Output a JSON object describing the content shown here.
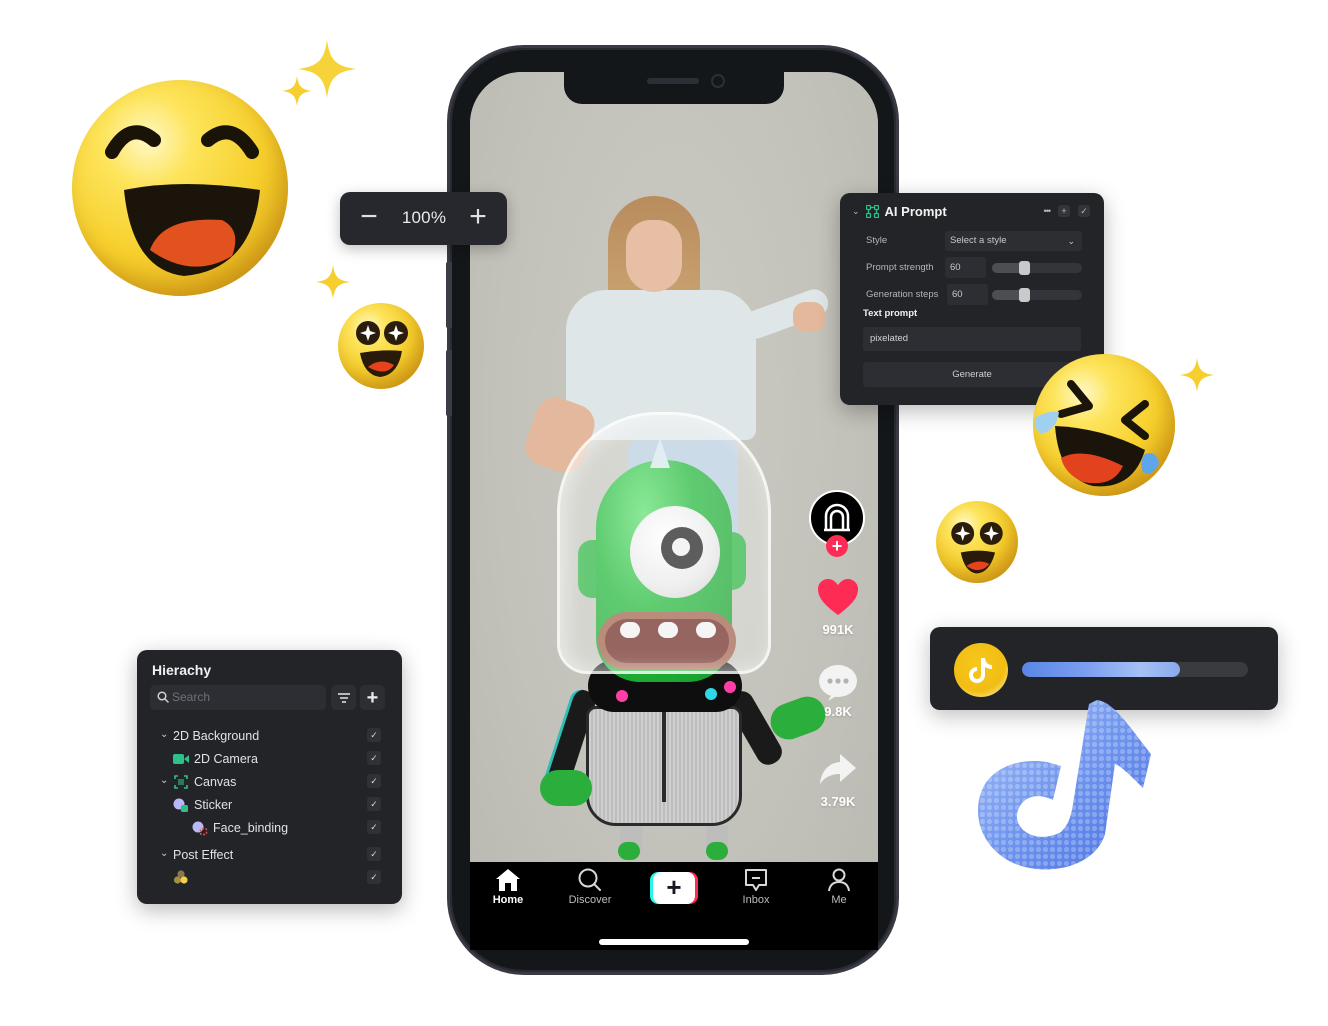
{
  "zoom_control": {
    "decrease_label": "−",
    "value": "100%",
    "increase_label": "+"
  },
  "ai_prompt_panel": {
    "title": "AI Prompt",
    "icon": "node-graph-icon",
    "actions": [
      "more-icon",
      "plus-icon",
      "check-icon"
    ],
    "style": {
      "label": "Style",
      "placeholder": "Select a style"
    },
    "prompt_strength": {
      "label": "Prompt strength",
      "value": "60",
      "slider_fraction": 0.36
    },
    "generation_steps": {
      "label": "Generation steps",
      "value": "60",
      "slider_fraction": 0.36
    },
    "text_prompt_label": "Text prompt",
    "text_prompt_value": "pixelated",
    "generate_label": "Generate",
    "accent_color": "#2ec08a"
  },
  "hierarchy_panel": {
    "title": "Hierachy",
    "search_placeholder": "Search",
    "filter_icon": "filter-icon",
    "add_icon": "plus-icon",
    "items": [
      {
        "label": "2D Background",
        "icon": "chevron-down",
        "checked": true
      },
      {
        "label": "2D Camera",
        "icon": "camera-icon",
        "checked": true
      },
      {
        "label": "Canvas",
        "icon": "canvas-icon",
        "checked": true
      },
      {
        "label": "Sticker",
        "icon": "sticker-icon",
        "checked": true
      },
      {
        "label": "Face_binding",
        "icon": "face-binding-icon",
        "checked": true
      },
      {
        "label": "Post Effect",
        "icon": "chevron-down",
        "checked": true
      },
      {
        "label": "",
        "icon": "post-effect-icon",
        "checked": true
      }
    ]
  },
  "phone": {
    "rail": {
      "likes": "991K",
      "comments": "9.8K",
      "shares": "3.79K"
    },
    "nav": [
      {
        "label": "Home",
        "icon": "home-icon",
        "active": true
      },
      {
        "label": "Discover",
        "icon": "search-icon",
        "active": false
      },
      {
        "label": "",
        "icon": "create-plus-icon",
        "active": false
      },
      {
        "label": "Inbox",
        "icon": "inbox-icon",
        "active": false
      },
      {
        "label": "Me",
        "icon": "profile-icon",
        "active": false
      }
    ],
    "brand_colors": {
      "red": "#fe2c55",
      "cyan": "#25f4ee"
    }
  },
  "progress_card": {
    "icon": "tiktok-coin-icon",
    "progress_percent": 70
  }
}
